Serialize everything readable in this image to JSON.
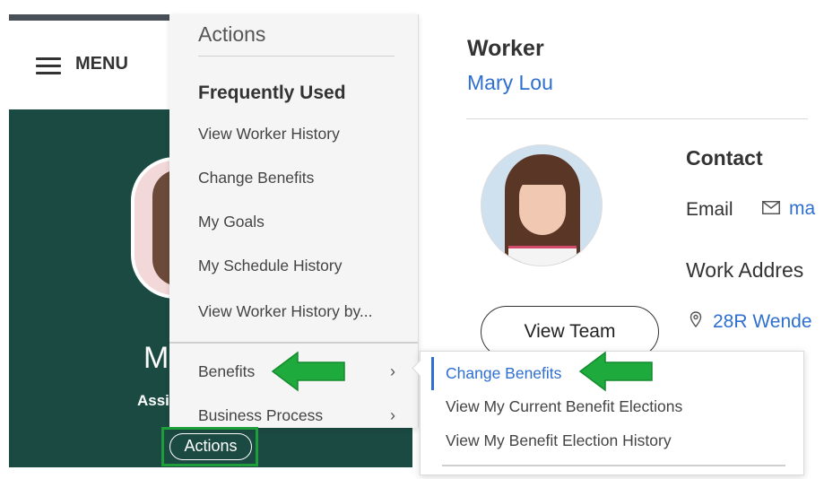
{
  "header": {
    "menu_label": "MENU"
  },
  "left_panel": {
    "initial": "M",
    "subtitle": "Assi",
    "actions_button": "Actions"
  },
  "actions_menu": {
    "title": "Actions",
    "frequently_used_heading": "Frequently Used",
    "frequently_used": [
      "View Worker History",
      "Change Benefits",
      "My Goals",
      "My Schedule History",
      "View Worker History by..."
    ],
    "categories": [
      {
        "label": "Benefits"
      },
      {
        "label": "Business Process"
      }
    ]
  },
  "benefits_submenu": {
    "items": [
      "Change Benefits",
      "View My Current Benefit Elections",
      "View My Benefit Election History"
    ]
  },
  "worker": {
    "title": "Worker",
    "name": "Mary Lou",
    "view_team_button": "View Team",
    "contact": {
      "title": "Contact",
      "email_label": "Email",
      "email_value": "ma",
      "work_address_label": "Work Addres",
      "work_address_value": "28R Wende"
    }
  },
  "icons": {
    "menu": "hamburger-icon",
    "email": "envelope-icon",
    "location": "map-pin-icon",
    "chevron": "chevron-right-icon",
    "annotation_arrow": "green-arrow-icon"
  },
  "colors": {
    "brand_green": "#1b4a42",
    "link_blue": "#2e6fcf",
    "annotation_green": "#1e9e3a"
  }
}
